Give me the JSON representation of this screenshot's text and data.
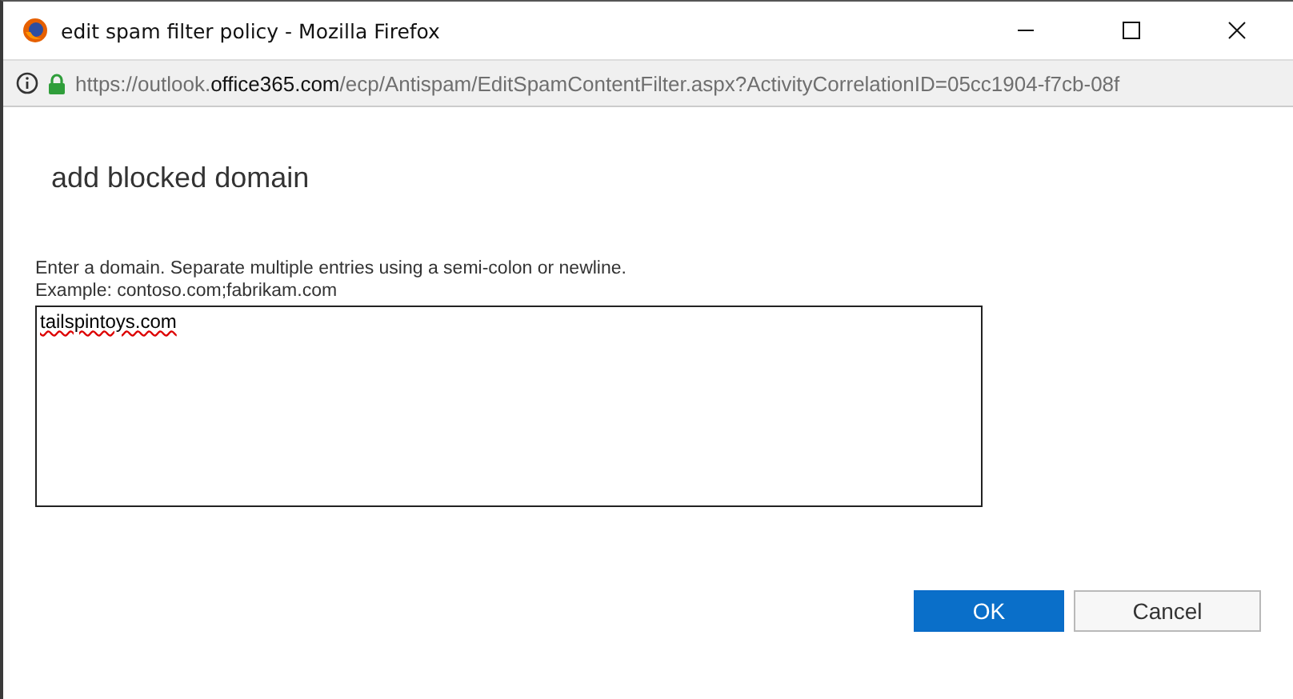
{
  "window": {
    "title": "edit spam filter policy - Mozilla Firefox"
  },
  "address_bar": {
    "url_parts": [
      {
        "text": "https://outlook.",
        "strong": false
      },
      {
        "text": "office365.com",
        "strong": true
      },
      {
        "text": "/ecp/Antispam/EditSpamContentFilter.aspx?ActivityCorrelationID=05cc1904-f7cb-08f",
        "strong": false
      }
    ]
  },
  "dialog": {
    "heading": "add blocked domain",
    "instructions": [
      "Enter a domain. Separate multiple entries using a semi-colon or newline.",
      "Example: contoso.com;fabrikam.com"
    ],
    "domains_field": {
      "value": "tailspintoys.com",
      "misspelled": true
    },
    "buttons": [
      {
        "label": "OK",
        "primary": true
      },
      {
        "label": "Cancel",
        "primary": false
      }
    ]
  }
}
